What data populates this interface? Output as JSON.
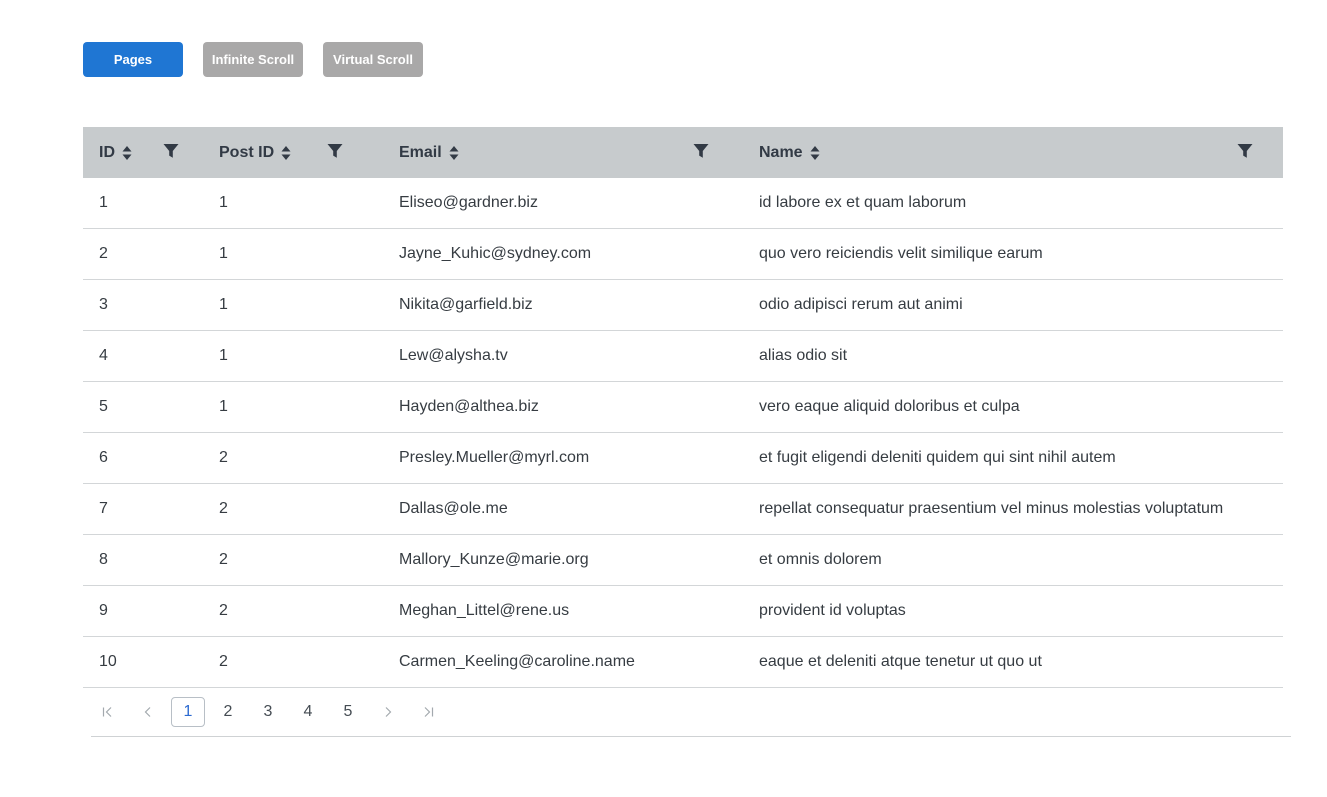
{
  "toolbar": {
    "buttons": [
      {
        "label": "Pages",
        "active": true
      },
      {
        "label": "Infinite Scroll",
        "active": false
      },
      {
        "label": "Virtual Scroll",
        "active": false
      }
    ]
  },
  "grid": {
    "columns": [
      {
        "title": "ID",
        "sort_icon": "sort-icon",
        "filter_icon": "filter-icon"
      },
      {
        "title": "Post ID",
        "sort_icon": "sort-icon",
        "filter_icon": "filter-icon"
      },
      {
        "title": "Email",
        "sort_icon": "sort-icon",
        "filter_icon": "filter-icon"
      },
      {
        "title": "Name",
        "sort_icon": "sort-icon",
        "filter_icon": "filter-icon"
      }
    ],
    "rows": [
      [
        "1",
        "1",
        "Eliseo@gardner.biz",
        "id labore ex et quam laborum"
      ],
      [
        "2",
        "1",
        "Jayne_Kuhic@sydney.com",
        "quo vero reiciendis velit similique earum"
      ],
      [
        "3",
        "1",
        "Nikita@garfield.biz",
        "odio adipisci rerum aut animi"
      ],
      [
        "4",
        "1",
        "Lew@alysha.tv",
        "alias odio sit"
      ],
      [
        "5",
        "1",
        "Hayden@althea.biz",
        "vero eaque aliquid doloribus et culpa"
      ],
      [
        "6",
        "2",
        "Presley.Mueller@myrl.com",
        "et fugit eligendi deleniti quidem qui sint nihil autem"
      ],
      [
        "7",
        "2",
        "Dallas@ole.me",
        "repellat consequatur praesentium vel minus molestias voluptatum"
      ],
      [
        "8",
        "2",
        "Mallory_Kunze@marie.org",
        "et omnis dolorem"
      ],
      [
        "9",
        "2",
        "Meghan_Littel@rene.us",
        "provident id voluptas"
      ],
      [
        "10",
        "2",
        "Carmen_Keeling@caroline.name",
        "eaque et deleniti atque tenetur ut quo ut"
      ]
    ]
  },
  "pager": {
    "first_icon": "first-page-icon",
    "prev_icon": "prev-page-icon",
    "next_icon": "next-page-icon",
    "last_icon": "last-page-icon",
    "pages": [
      "1",
      "2",
      "3",
      "4",
      "5"
    ],
    "current_page": "1"
  },
  "colors": {
    "primary": "#1f76d3",
    "inactive_button": "#a9a8a8",
    "header_bg": "#c7cbcd",
    "current_page_text": "#2d6bd1"
  }
}
